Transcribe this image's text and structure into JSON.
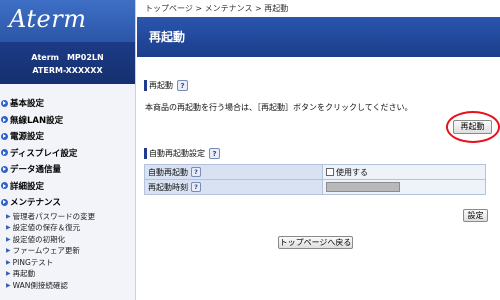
{
  "brand": {
    "logo": "Aterm",
    "model_line1": "Aterm　MP02LN",
    "model_line2": "ATERM-XXXXXX"
  },
  "sidebar": {
    "items": [
      {
        "label": "基本設定"
      },
      {
        "label": "無線LAN設定"
      },
      {
        "label": "電源設定"
      },
      {
        "label": "ディスプレイ設定"
      },
      {
        "label": "データ通信量"
      },
      {
        "label": "詳細設定"
      },
      {
        "label": "メンテナンス"
      }
    ],
    "subitems": [
      {
        "label": "管理者パスワードの変更"
      },
      {
        "label": "設定値の保存＆復元"
      },
      {
        "label": "設定値の初期化"
      },
      {
        "label": "ファームウェア更新"
      },
      {
        "label": "PINGテスト"
      },
      {
        "label": "再起動"
      },
      {
        "label": "WAN側接続確認"
      }
    ]
  },
  "breadcrumb": "トップページ > メンテナンス > 再起動",
  "page_title": "再起動",
  "restart_section": {
    "heading": "再起動",
    "description": "本商品の再起動を行う場合は、［再起動］ボタンをクリックしてください。",
    "button": "再起動"
  },
  "auto_restart": {
    "heading": "自動再起動設定",
    "rows": [
      {
        "label": "自動再起動",
        "value": "使用する"
      },
      {
        "label": "再起動時刻",
        "value": ""
      }
    ],
    "set_button": "設定"
  },
  "help_label": "?",
  "back_button": "トップページへ戻る",
  "colors": {
    "header_blue": "#1c3d8b",
    "highlight_red": "#e8101a",
    "row_label_bg": "#d8e2f3"
  }
}
